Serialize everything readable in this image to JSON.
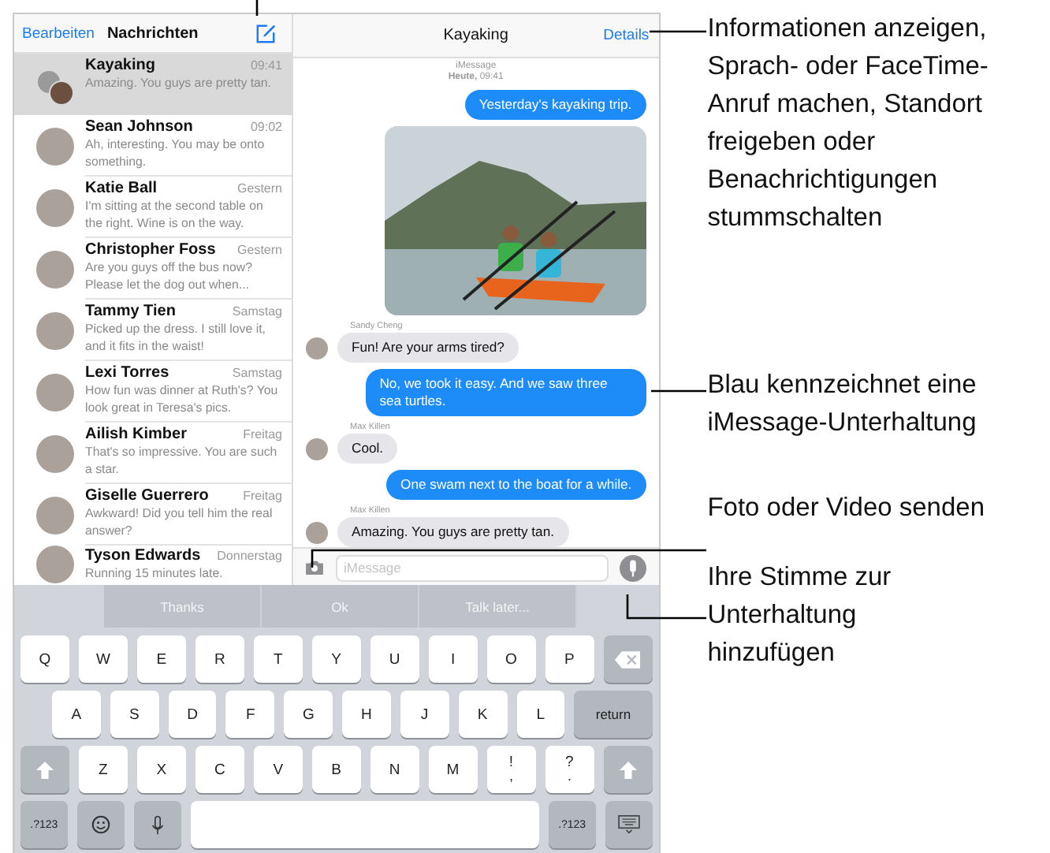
{
  "sidebar": {
    "edit": "Bearbeiten",
    "title": "Nachrichten",
    "conversations": [
      {
        "name": "Kayaking",
        "time": "09:41",
        "preview": "Amazing. You guys are pretty tan.",
        "group": true,
        "selected": true
      },
      {
        "name": "Sean Johnson",
        "time": "09:02",
        "preview": "Ah, interesting. You may be onto something.",
        "group": false,
        "selected": false
      },
      {
        "name": "Katie Ball",
        "time": "Gestern",
        "preview": "I'm sitting at the second table on the right. Wine is on the way.",
        "group": false,
        "selected": false
      },
      {
        "name": "Christopher Foss",
        "time": "Gestern",
        "preview": "Are you guys off the bus now? Please let the dog out when...",
        "group": false,
        "selected": false
      },
      {
        "name": "Tammy Tien",
        "time": "Samstag",
        "preview": "Picked up the dress. I still love it, and it fits in the waist!",
        "group": false,
        "selected": false
      },
      {
        "name": "Lexi Torres",
        "time": "Samstag",
        "preview": "How fun was dinner at Ruth's? You look great in Teresa's pics.",
        "group": false,
        "selected": false
      },
      {
        "name": "Ailish Kimber",
        "time": "Freitag",
        "preview": "That's so impressive. You are such a star.",
        "group": false,
        "selected": false
      },
      {
        "name": "Giselle Guerrero",
        "time": "Freitag",
        "preview": "Awkward! Did you tell him the real answer?",
        "group": false,
        "selected": false
      },
      {
        "name": "Tyson Edwards",
        "time": "Donnerstag",
        "preview": "Running 15 minutes late.",
        "group": false,
        "selected": false
      }
    ]
  },
  "chat": {
    "title": "Kayaking",
    "details": "Details",
    "service": "iMessage",
    "timestamp": "**Heute,** 09:41",
    "messages": [
      {
        "kind": "outgoing",
        "text": "Yesterday's kayaking trip."
      },
      {
        "kind": "photo"
      },
      {
        "kind": "incoming",
        "sender": "Sandy Cheng",
        "text": "Fun! Are your arms tired?"
      },
      {
        "kind": "outgoing",
        "text": "No, we took it easy. And we saw three sea turtles."
      },
      {
        "kind": "incoming",
        "sender": "Max Killen",
        "text": "Cool."
      },
      {
        "kind": "outgoing",
        "text": "One swam next to the boat for a while."
      },
      {
        "kind": "incoming",
        "sender": "Max Killen",
        "text": "Amazing. You guys are pretty tan."
      }
    ],
    "input": {
      "placeholder": "iMessage"
    }
  },
  "keyboard": {
    "suggestions": [
      "Thanks",
      "Ok",
      "Talk later..."
    ],
    "rows": [
      {
        "keys": [
          {
            "kind": "letter",
            "label": "Q"
          },
          {
            "kind": "letter",
            "label": "W"
          },
          {
            "kind": "letter",
            "label": "E"
          },
          {
            "kind": "letter",
            "label": "R"
          },
          {
            "kind": "letter",
            "label": "T"
          },
          {
            "kind": "letter",
            "label": "Y"
          },
          {
            "kind": "letter",
            "label": "U"
          },
          {
            "kind": "letter",
            "label": "I"
          },
          {
            "kind": "letter",
            "label": "O"
          },
          {
            "kind": "letter",
            "label": "P"
          },
          {
            "kind": "delete"
          }
        ]
      },
      {
        "keys": [
          {
            "kind": "letter",
            "label": "A"
          },
          {
            "kind": "letter",
            "label": "S"
          },
          {
            "kind": "letter",
            "label": "D"
          },
          {
            "kind": "letter",
            "label": "F"
          },
          {
            "kind": "letter",
            "label": "G"
          },
          {
            "kind": "letter",
            "label": "H"
          },
          {
            "kind": "letter",
            "label": "J"
          },
          {
            "kind": "letter",
            "label": "K"
          },
          {
            "kind": "letter",
            "label": "L"
          },
          {
            "kind": "return",
            "label": "return"
          }
        ]
      },
      {
        "keys": [
          {
            "kind": "shift"
          },
          {
            "kind": "letter",
            "label": "Z"
          },
          {
            "kind": "letter",
            "label": "X"
          },
          {
            "kind": "letter",
            "label": "C"
          },
          {
            "kind": "letter",
            "label": "V"
          },
          {
            "kind": "letter",
            "label": "B"
          },
          {
            "kind": "letter",
            "label": "N"
          },
          {
            "kind": "letter",
            "label": "M"
          },
          {
            "kind": "punct",
            "label": "!",
            "sub": ","
          },
          {
            "kind": "punct",
            "label": "?",
            "sub": "."
          },
          {
            "kind": "shift"
          }
        ]
      },
      {
        "keys": [
          {
            "kind": "mode",
            "label": ".?123"
          },
          {
            "kind": "emoji"
          },
          {
            "kind": "dictation"
          },
          {
            "kind": "space"
          },
          {
            "kind": "mode",
            "label": ".?123"
          },
          {
            "kind": "hide"
          }
        ]
      }
    ]
  },
  "callouts": [
    "Informationen anzeigen, Sprach- oder FaceTime-Anruf machen, Standort freigeben oder Benachrichtigungen stummschalten",
    "Blau kennzeichnet eine iMessage-Unterhaltung",
    "Foto oder Video senden",
    "Ihre Stimme zur Unterhaltung hinzufügen"
  ]
}
